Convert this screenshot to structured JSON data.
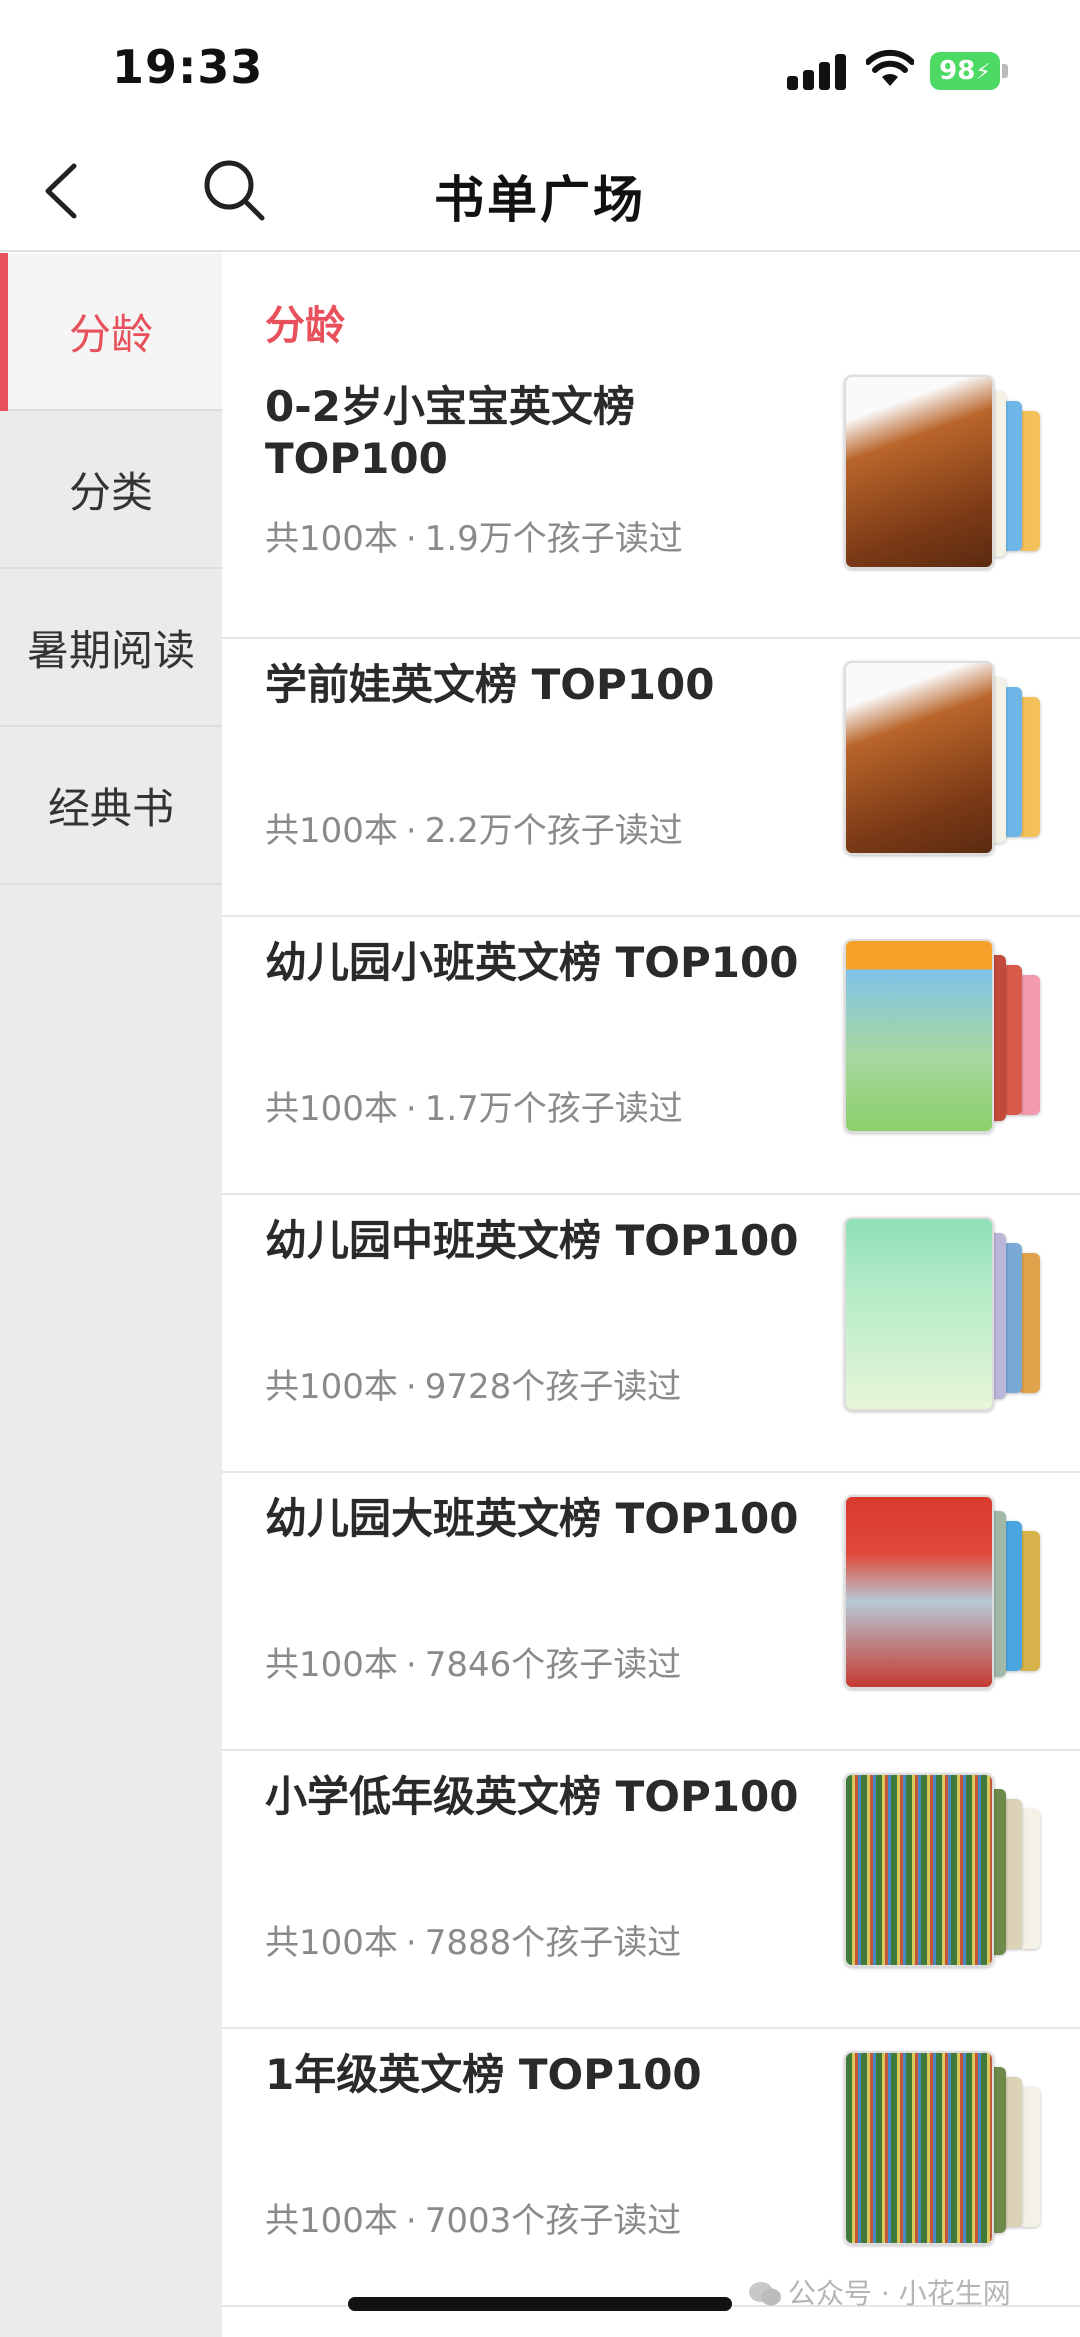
{
  "status_bar": {
    "time": "19:33",
    "battery": "98",
    "icons": [
      "cellular-signal-icon",
      "wifi-icon",
      "battery-charging-icon"
    ]
  },
  "nav": {
    "title": "书单广场",
    "back_icon": "chevron-left-icon",
    "search_icon": "search-icon"
  },
  "sidebar": {
    "items": [
      {
        "label": "分龄",
        "active": true
      },
      {
        "label": "分类",
        "active": false
      },
      {
        "label": "暑期阅读",
        "active": false
      },
      {
        "label": "经典书",
        "active": false
      }
    ]
  },
  "content": {
    "section_title": "分龄",
    "items": [
      {
        "title": "0-2岁小宝宝英文榜 TOP100",
        "count": "共100本",
        "readers": "1.9万个孩子读过"
      },
      {
        "title": "学前娃英文榜 TOP100",
        "count": "共100本",
        "readers": "2.2万个孩子读过"
      },
      {
        "title": "幼儿园小班英文榜 TOP100",
        "count": "共100本",
        "readers": "1.7万个孩子读过"
      },
      {
        "title": "幼儿园中班英文榜 TOP100",
        "count": "共100本",
        "readers": "9728个孩子读过"
      },
      {
        "title": "幼儿园大班英文榜 TOP100",
        "count": "共100本",
        "readers": "7846个孩子读过"
      },
      {
        "title": "小学低年级英文榜 TOP100",
        "count": "共100本",
        "readers": "7888个孩子读过"
      },
      {
        "title": "1年级英文榜 TOP100",
        "count": "共100本",
        "readers": "7003个孩子读过"
      }
    ]
  },
  "watermark": {
    "text": "公众号 · 小花生网"
  },
  "colors": {
    "accent": "#e8505b",
    "sidebar_bg": "#ebebeb",
    "battery": "#4cd964"
  }
}
